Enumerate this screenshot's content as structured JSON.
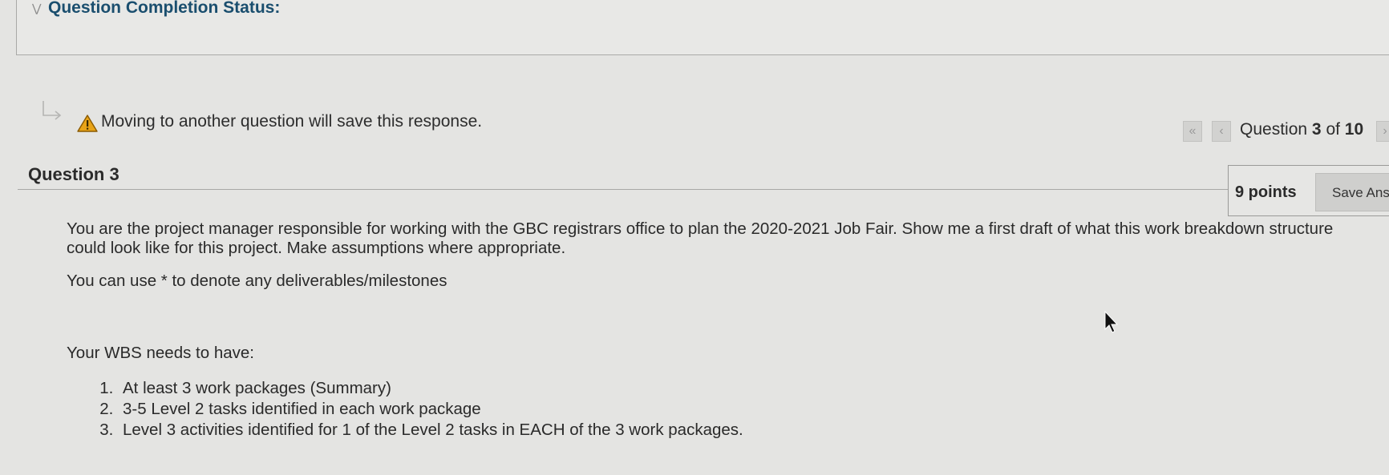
{
  "completion": {
    "title": "Question Completion Status:"
  },
  "warning": {
    "text": "Moving to another question will save this response."
  },
  "navigation": {
    "first_icon": "double-chevron-left-icon",
    "prev_icon": "chevron-left-icon",
    "next_icon": "chevron-right-icon",
    "prefix": "Question",
    "current": "3",
    "of_label": "of",
    "total": "10"
  },
  "question": {
    "title": "Question 3",
    "points": "9 points",
    "save_label": "Save Answer",
    "paragraph1": "You are the project manager responsible for working with the GBC registrars office to plan the 2020-2021 Job Fair.  Show me a first draft of what this work breakdown structure could look like for this project.  Make assumptions where appropriate.",
    "paragraph2": "You can use * to denote any deliverables/milestones",
    "paragraph3": "Your WBS needs to have:",
    "requirements": [
      "At least 3 work packages (Summary)",
      "3-5 Level 2 tasks identified in each work package",
      "Level 3 activities identified for 1 of the Level 2 tasks in EACH of the 3 work packages."
    ]
  },
  "colors": {
    "heading": "#1a4e6e",
    "warning": "#e8a317",
    "background": "#e4e4e2"
  }
}
